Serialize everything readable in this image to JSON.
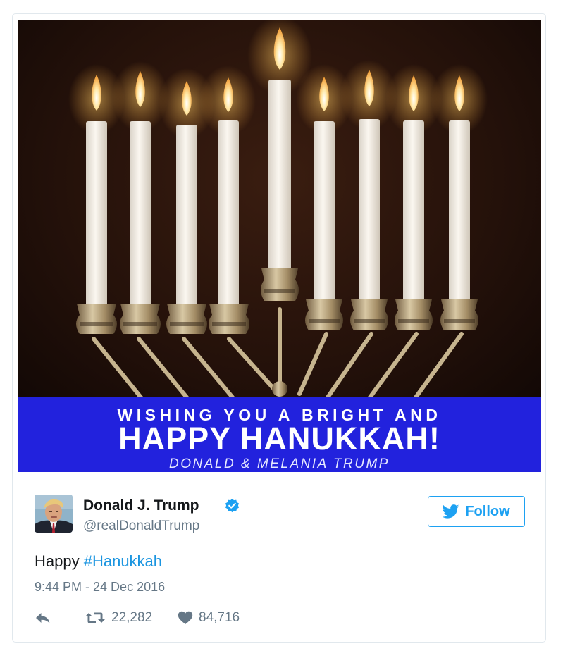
{
  "media": {
    "banner_line1": "WISHING YOU A BRIGHT AND",
    "banner_line2": "HAPPY HANUKKAH!",
    "banner_line3": "DONALD & MELANIA TRUMP",
    "banner_color": "#2222dd"
  },
  "author": {
    "name": "Donald J. Trump",
    "handle": "@realDonaldTrump",
    "verified": true
  },
  "follow": {
    "label": "Follow"
  },
  "tweet": {
    "text_prefix": "Happy ",
    "hashtag": "#Hanukkah",
    "timestamp": "9:44 PM - 24 Dec 2016"
  },
  "actions": {
    "retweets": "22,282",
    "likes": "84,716"
  },
  "colors": {
    "link": "#1b95e0",
    "twitter_blue": "#1da1f2",
    "muted": "#657786",
    "text": "#14171a",
    "border": "#e1e8ed"
  },
  "icons": {
    "reply": "reply-icon",
    "retweet": "retweet-icon",
    "like": "heart-icon",
    "bird": "twitter-bird-icon",
    "verified": "verified-badge-icon"
  }
}
